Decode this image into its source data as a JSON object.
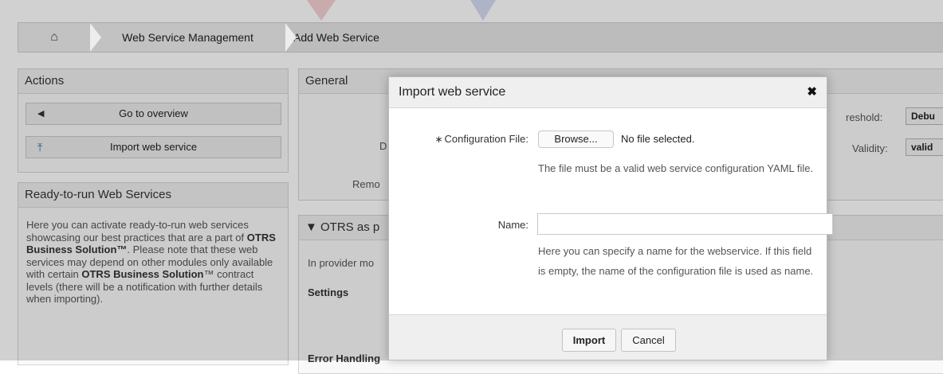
{
  "breadcrumb": {
    "home_icon": "home-icon",
    "items": [
      "Web Service Management",
      "Add Web Service"
    ]
  },
  "actions": {
    "title": "Actions",
    "buttons": [
      {
        "label": "Go to overview",
        "icon": "caret-left-icon"
      },
      {
        "label": "Import web service",
        "icon": "upload-icon"
      }
    ]
  },
  "ready": {
    "title": "Ready-to-run Web Services",
    "text_1": "Here you can activate ready-to-run web services showcasing our best practices that are a part of ",
    "brand_1": "OTRS Business Solution™",
    "text_2": ". Please note that these web services may depend on other modules only available with certain ",
    "brand_2": "OTRS Business Solution",
    "text_3": "™ contract levels (there will be a notification with further details when importing)."
  },
  "general": {
    "title": "General",
    "label_d": "D",
    "label_remo": "Remo",
    "threshold_label": "reshold:",
    "threshold_value": "Debu",
    "validity_label": "Validity:",
    "validity_value": "valid"
  },
  "otrs": {
    "title": "▼ OTRS as p",
    "text": "In provider mo",
    "settings": "Settings",
    "error_handling": "Error Handling"
  },
  "dialog": {
    "title": "Import web service",
    "close_icon": "close-icon",
    "config_label": "Configuration File:",
    "required_mark": "∗",
    "browse_label": "Browse...",
    "no_file": "No file selected.",
    "config_hint": "The file must be a valid web service configuration YAML file.",
    "name_label": "Name:",
    "name_value": "",
    "name_hint": "Here you can specify a name for the webservice. If this field is empty, the name of the configuration file is used as name.",
    "import_label": "Import",
    "cancel_label": "Cancel"
  }
}
